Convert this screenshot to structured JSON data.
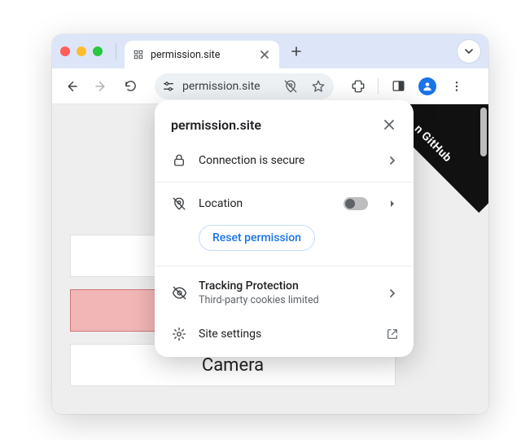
{
  "tab": {
    "title": "permission.site",
    "favicon_glyph": "⚙"
  },
  "omnibox": {
    "url": "permission.site"
  },
  "popover": {
    "title": "permission.site",
    "connection_label": "Connection is secure",
    "location_label": "Location",
    "reset_label": "Reset permission",
    "tracking_label": "Tracking Protection",
    "tracking_sub": "Third-party cookies limited",
    "site_settings_label": "Site settings"
  },
  "page": {
    "ribbon_text": "n GitHub",
    "card3_label": "Camera"
  }
}
